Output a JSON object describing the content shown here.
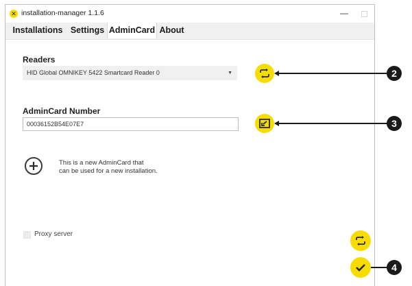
{
  "window": {
    "title": "installation-manager 1.1.6",
    "app_icon_glyph": "✕",
    "minimize_glyph": "—"
  },
  "tabs": [
    {
      "label": "Installations",
      "active": false
    },
    {
      "label": "Settings",
      "active": false
    },
    {
      "label": "AdminCard",
      "active": true
    },
    {
      "label": "About",
      "active": false
    }
  ],
  "readers": {
    "label": "Readers",
    "selected": "HID Global OMNIKEY 5422 Smartcard Reader 0",
    "refresh_icon": "refresh-icon"
  },
  "admincard": {
    "label": "AdminCard Number",
    "value": "00036152B54E07E7",
    "import_icon": "import-icon"
  },
  "new_card": {
    "line1": "This is a new AdminCard that",
    "line2": "can be used for a new installation."
  },
  "proxy": {
    "label": "Proxy server",
    "checked": false
  },
  "callouts": [
    "2",
    "3",
    "4"
  ],
  "colors": {
    "accent": "#f7dc00",
    "callout": "#1a1a1a"
  }
}
